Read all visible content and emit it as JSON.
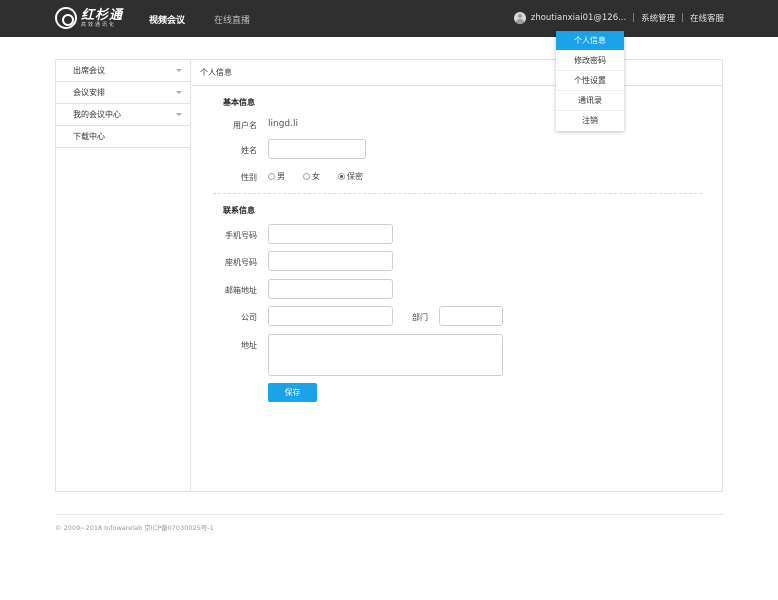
{
  "brand": {
    "name": "红杉通",
    "tagline": "高效通讯化"
  },
  "nav": [
    {
      "label": "视频会议",
      "active": true
    },
    {
      "label": "在线直播",
      "active": false
    }
  ],
  "user": {
    "email": "zhoutianxiai01@126...",
    "separator": "|",
    "links": [
      "系统管理",
      "在线客服"
    ]
  },
  "dropdown": [
    {
      "label": "个人信息",
      "active": true
    },
    {
      "label": "修改密码",
      "active": false
    },
    {
      "label": "个性设置",
      "active": false
    },
    {
      "label": "通讯录",
      "active": false
    },
    {
      "label": "注销",
      "active": false
    }
  ],
  "sidebar": [
    {
      "label": "出席会议",
      "expandable": true
    },
    {
      "label": "会议安排",
      "expandable": true
    },
    {
      "label": "我的会议中心",
      "expandable": true
    },
    {
      "label": "下载中心",
      "expandable": false
    }
  ],
  "panel": {
    "title": "个人信息"
  },
  "basic": {
    "title": "基本信息",
    "username_label": "用户名",
    "username_value": "lingd.li",
    "name_label": "姓名",
    "name_value": "",
    "gender_label": "性别",
    "gender_options": [
      {
        "label": "男",
        "checked": false
      },
      {
        "label": "女",
        "checked": false
      },
      {
        "label": "保密",
        "checked": true
      }
    ]
  },
  "contact": {
    "title": "联系信息",
    "mobile_label": "手机号码",
    "mobile_value": "",
    "phone_label": "座机号码",
    "phone_value": "",
    "email_label": "邮箱地址",
    "email_value": "",
    "company_label": "公司",
    "company_value": "",
    "dept_label": "部门",
    "dept_value": "",
    "address_label": "地址",
    "address_value": ""
  },
  "actions": {
    "save_label": "保存"
  },
  "footer": {
    "copyright": "© 2009~2018 Infowarelab 京ICP备07030025号-1"
  },
  "colors": {
    "accent": "#1aa3e8",
    "topbar": "#2f2f2f"
  }
}
